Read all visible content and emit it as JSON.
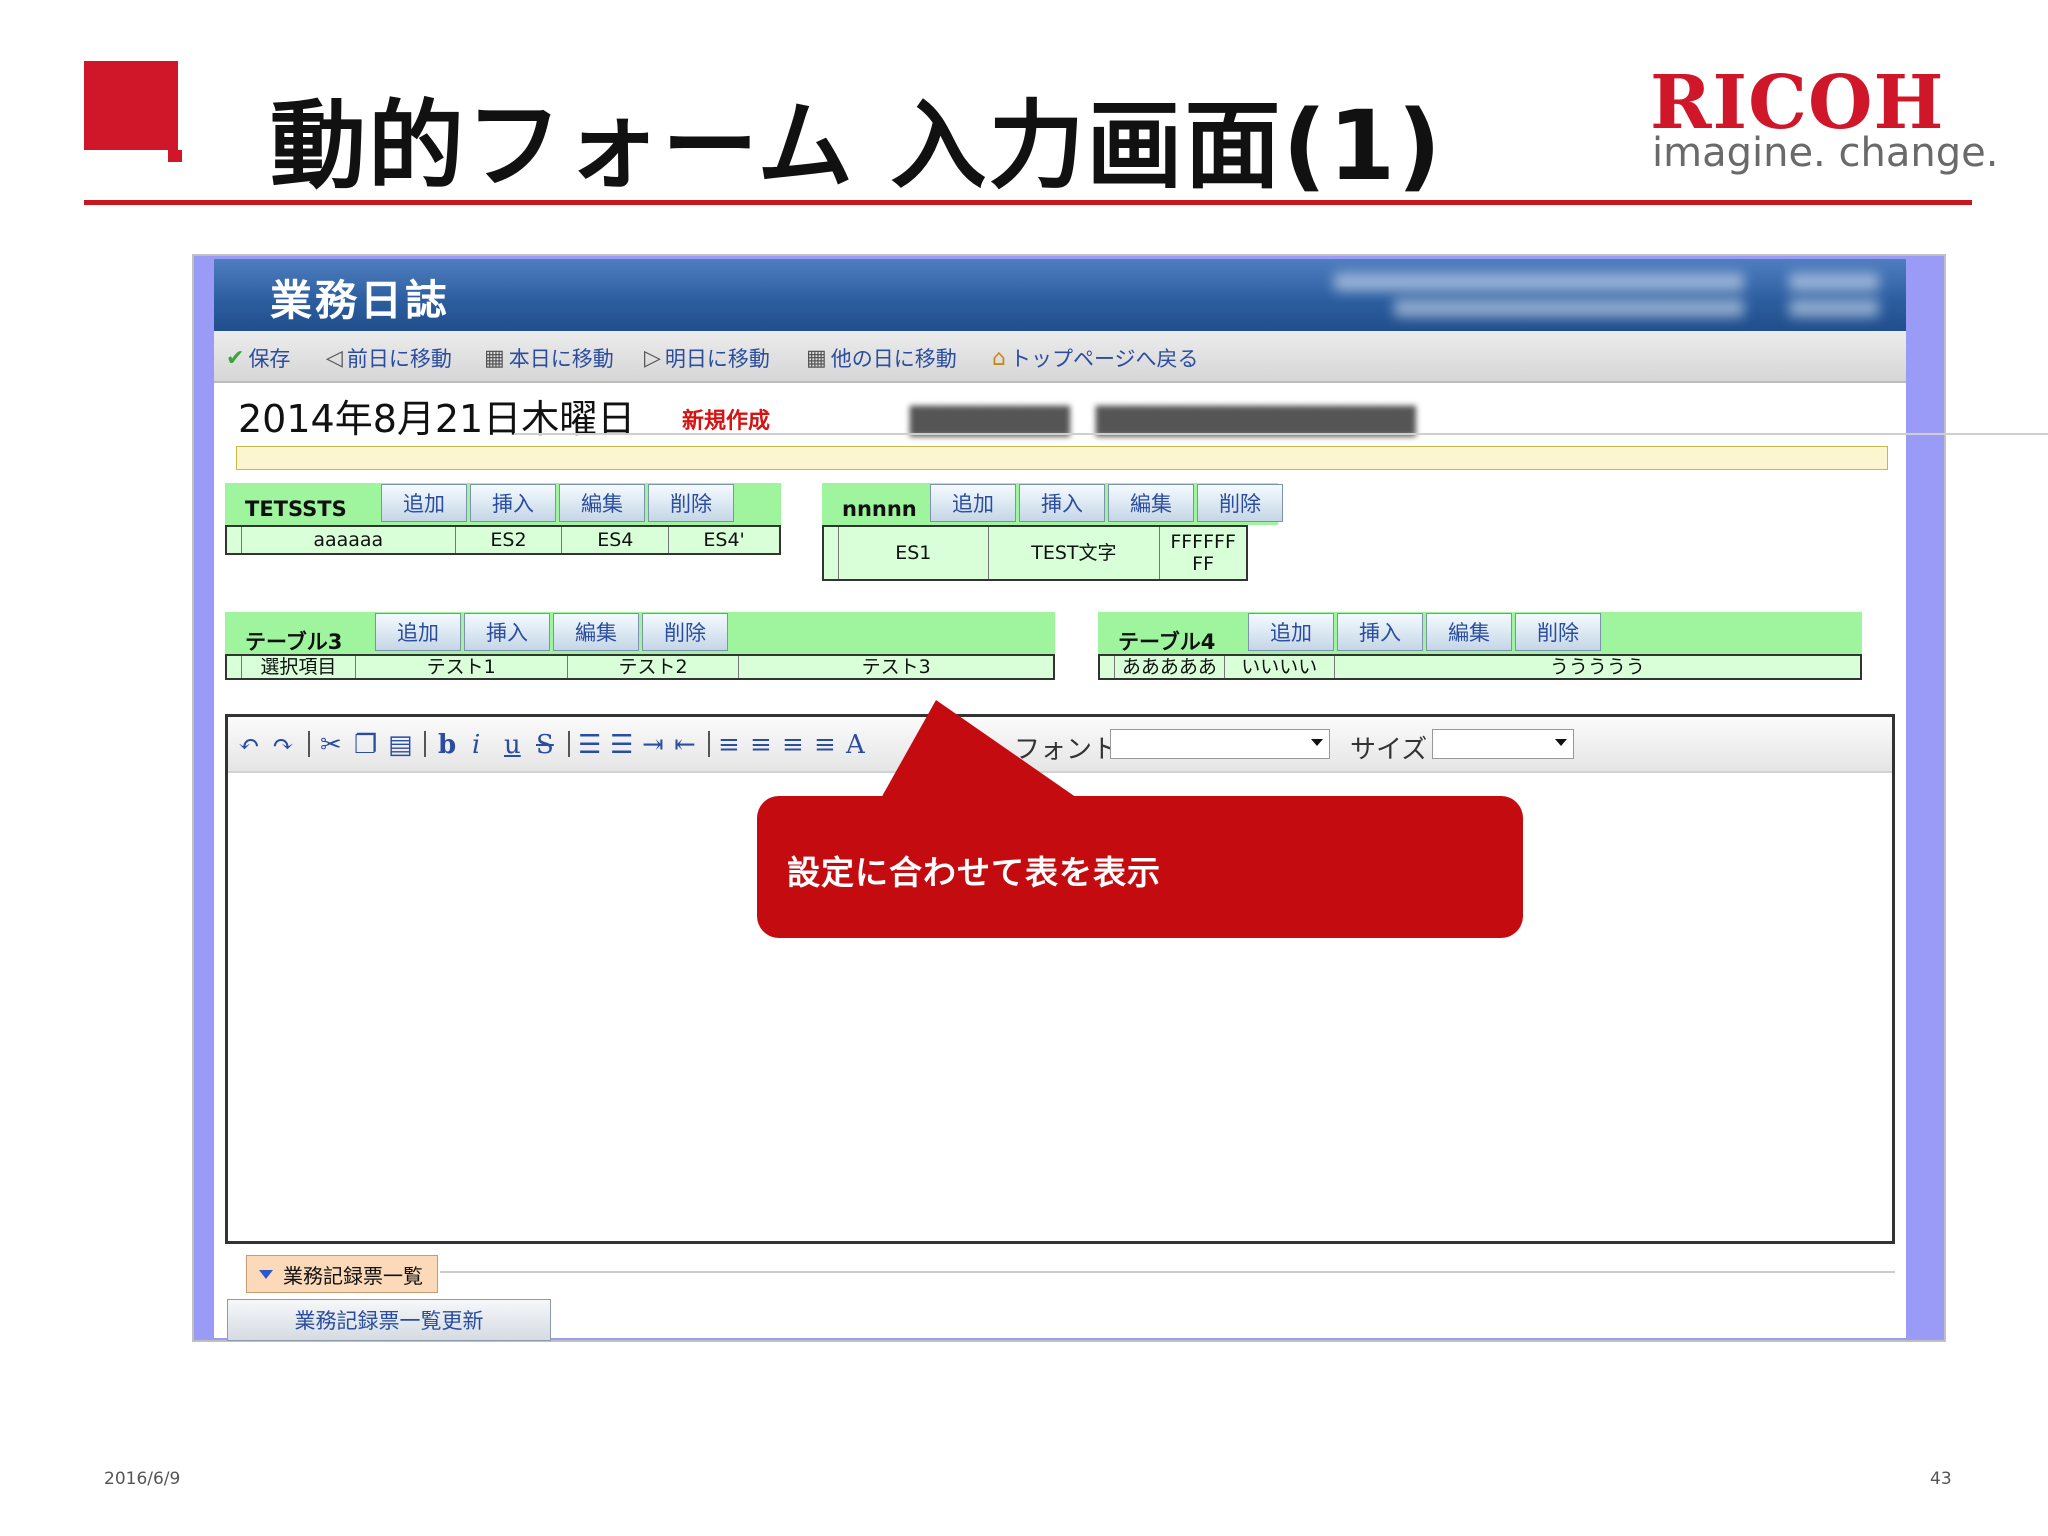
{
  "slide": {
    "title": "動的フォーム 入力画面(1)",
    "brand": {
      "name": "RICOH",
      "tagline": "imagine. change."
    },
    "footer": {
      "date": "2016/6/9",
      "page": "43"
    }
  },
  "app": {
    "title": "業務日誌",
    "toolbar": [
      {
        "icon": "check-icon",
        "label": "保存"
      },
      {
        "icon": "prev-day-icon",
        "label": "前日に移動"
      },
      {
        "icon": "calendar-today-icon",
        "label": "本日に移動"
      },
      {
        "icon": "next-day-icon",
        "label": "明日に移動"
      },
      {
        "icon": "calendar-other-icon",
        "label": "他の日に移動"
      },
      {
        "icon": "home-icon",
        "label": "トップページへ戻る"
      }
    ],
    "date_heading": "2014年8月21日木曜日",
    "new_badge": "新規作成",
    "buttons": {
      "add": "追加",
      "insert": "挿入",
      "edit": "編集",
      "delete": "削除"
    },
    "tables": [
      {
        "name": "TETSSTS",
        "cells": [
          "aaaaaa",
          "ES2",
          "ES4",
          "ES4'"
        ]
      },
      {
        "name": "nnnnn",
        "cells": [
          "ES1",
          "TEST文字",
          "FFFFFF FF"
        ]
      },
      {
        "name": "テーブル3",
        "cells": [
          "選択項目",
          "テスト1",
          "テスト2",
          "テスト3"
        ]
      },
      {
        "name": "テーブル4",
        "cells": [
          "あああああ",
          "いいいい",
          "ううううう"
        ]
      }
    ],
    "editor": {
      "font_label": "フォント",
      "size_label": "サイズ",
      "font_value": "",
      "size_value": ""
    },
    "list_section": {
      "tab_label": "業務記録票一覧",
      "refresh_button": "業務記録票一覧更新"
    }
  },
  "callout": {
    "text": "設定に合わせて表を表示"
  },
  "colors": {
    "accent_red": "#d0172a",
    "header_blue": "#2b5d9e",
    "frame_lavender": "#9a9af7",
    "table_green": "#9ef59e",
    "callout_red": "#c40b10"
  }
}
